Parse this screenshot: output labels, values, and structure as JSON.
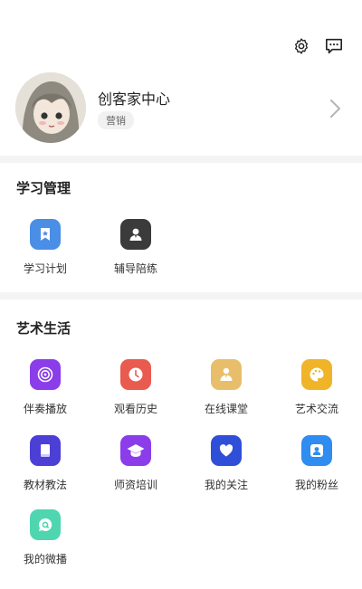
{
  "header": {
    "settings_icon": "gear-icon",
    "message_icon": "chat-bubble-icon"
  },
  "profile": {
    "name": "创客家中心",
    "tag": "营销"
  },
  "sections": [
    {
      "title": "学习管理",
      "items": [
        {
          "label": "学习计划",
          "icon": "bookmark-icon",
          "color": "#4a8ee6"
        },
        {
          "label": "辅导陪练",
          "icon": "person-icon",
          "color": "#3b3b3b"
        }
      ]
    },
    {
      "title": "艺术生活",
      "items": [
        {
          "label": "伴奏播放",
          "icon": "play-icon",
          "color": "#8a3de8"
        },
        {
          "label": "观看历史",
          "icon": "clock-icon",
          "color": "#e85b4e"
        },
        {
          "label": "在线课堂",
          "icon": "teacher-icon",
          "color": "#e8be6a"
        },
        {
          "label": "艺术交流",
          "icon": "palette-icon",
          "color": "#f0b429"
        },
        {
          "label": "教材教法",
          "icon": "book-icon",
          "color": "#4b3fd6"
        },
        {
          "label": "师资培训",
          "icon": "graduation-cap-icon",
          "color": "#8a3de8"
        },
        {
          "label": "我的关注",
          "icon": "heart-icon",
          "color": "#2f4fd8"
        },
        {
          "label": "我的粉丝",
          "icon": "fan-user-icon",
          "color": "#2f8cf0"
        },
        {
          "label": "我的微播",
          "icon": "chat-q-icon",
          "color": "#4fd6b0"
        }
      ]
    }
  ]
}
